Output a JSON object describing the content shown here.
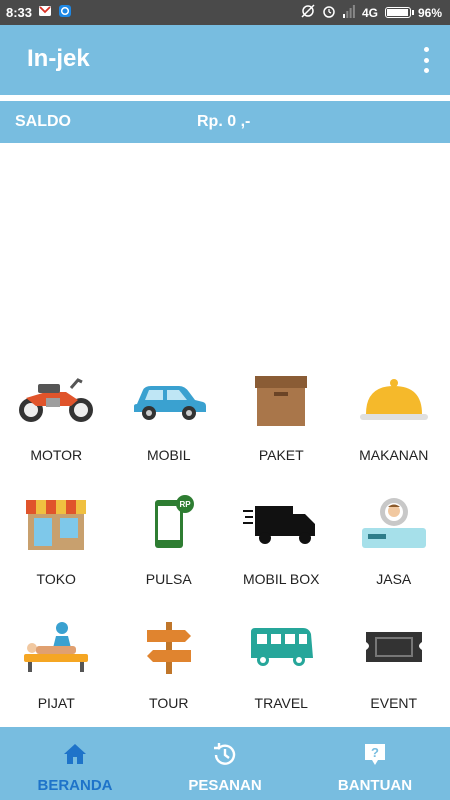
{
  "status_bar": {
    "time": "8:33",
    "network": "4G",
    "battery_percent": "96%",
    "battery_level": 0.96,
    "icons": [
      "gmail-icon",
      "chat-icon",
      "sync-off-icon",
      "alarm-icon",
      "signal-icon",
      "battery-icon"
    ]
  },
  "app_bar": {
    "title": "In-jek",
    "menu_icon": "more-vertical-icon"
  },
  "saldo": {
    "label": "SALDO",
    "value": "Rp. 0 ,-"
  },
  "services": [
    {
      "label": "MOTOR",
      "icon": "motorcycle-icon"
    },
    {
      "label": "MOBIL",
      "icon": "car-icon"
    },
    {
      "label": "PAKET",
      "icon": "package-box-icon"
    },
    {
      "label": "MAKANAN",
      "icon": "food-cloche-icon"
    },
    {
      "label": "TOKO",
      "icon": "store-icon"
    },
    {
      "label": "PULSA",
      "icon": "phone-credit-icon"
    },
    {
      "label": "MOBIL BOX",
      "icon": "delivery-truck-icon"
    },
    {
      "label": "JASA",
      "icon": "service-worker-icon"
    },
    {
      "label": "PIJAT",
      "icon": "massage-icon"
    },
    {
      "label": "TOUR",
      "icon": "signpost-icon"
    },
    {
      "label": "TRAVEL",
      "icon": "bus-icon"
    },
    {
      "label": "EVENT",
      "icon": "ticket-icon"
    }
  ],
  "bottom_nav": [
    {
      "label": "BERANDA",
      "icon": "home-icon",
      "active": true
    },
    {
      "label": "PESANAN",
      "icon": "history-icon",
      "active": false
    },
    {
      "label": "BANTUAN",
      "icon": "help-icon",
      "active": false
    }
  ],
  "colors": {
    "primary": "#78bde0",
    "active_tab": "#1e73c9",
    "status_bar": "#4a4a4a"
  }
}
